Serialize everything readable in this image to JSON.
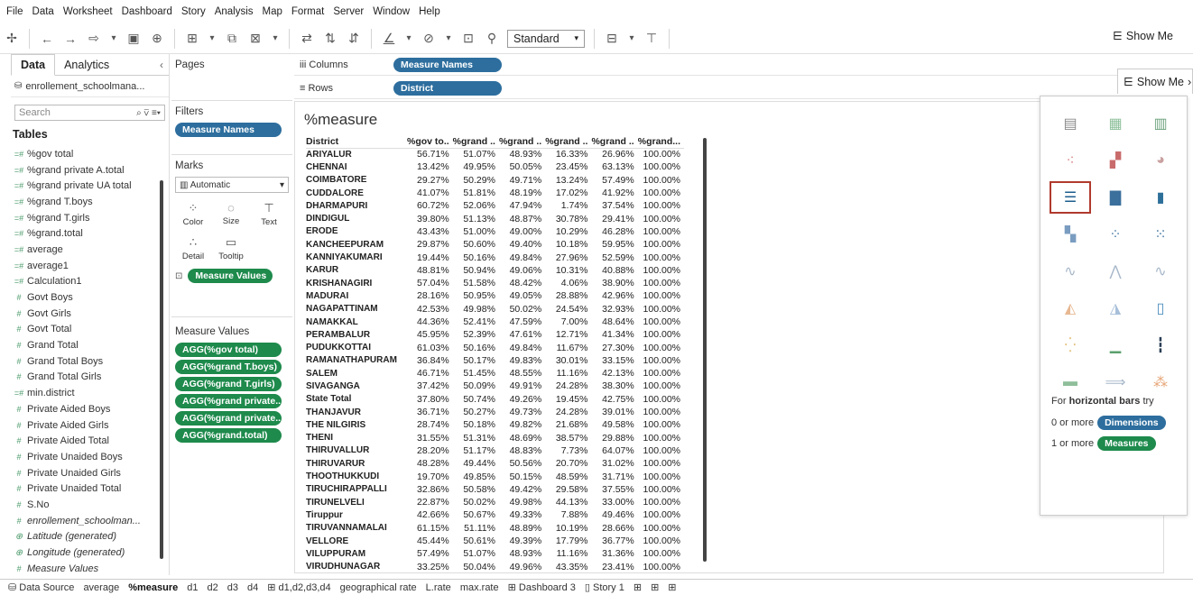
{
  "menu": [
    "File",
    "Data",
    "Worksheet",
    "Dashboard",
    "Story",
    "Analysis",
    "Map",
    "Format",
    "Server",
    "Window",
    "Help"
  ],
  "toolbar": {
    "fit": "Standard",
    "show_me": "Show Me"
  },
  "data_pane": {
    "tabs": [
      "Data",
      "Analytics"
    ],
    "source": "enrollement_schoolmana...",
    "search_placeholder": "Search",
    "tables_heading": "Tables",
    "fields": [
      {
        "type": "=#",
        "name": "%gov total",
        "italic": false
      },
      {
        "type": "=#",
        "name": "%grand private A.total",
        "italic": false
      },
      {
        "type": "=#",
        "name": "%grand private UA total",
        "italic": false
      },
      {
        "type": "=#",
        "name": "%grand T.boys",
        "italic": false
      },
      {
        "type": "=#",
        "name": "%grand T.girls",
        "italic": false
      },
      {
        "type": "=#",
        "name": "%grand.total",
        "italic": false
      },
      {
        "type": "=#",
        "name": "average",
        "italic": false
      },
      {
        "type": "=#",
        "name": "average1",
        "italic": false
      },
      {
        "type": "=#",
        "name": "Calculation1",
        "italic": false
      },
      {
        "type": "#",
        "name": "Govt Boys",
        "italic": false
      },
      {
        "type": "#",
        "name": "Govt Girls",
        "italic": false
      },
      {
        "type": "#",
        "name": "Govt Total",
        "italic": false
      },
      {
        "type": "#",
        "name": "Grand Total",
        "italic": false
      },
      {
        "type": "#",
        "name": "Grand Total Boys",
        "italic": false
      },
      {
        "type": "#",
        "name": "Grand Total Girls",
        "italic": false
      },
      {
        "type": "=#",
        "name": "min.district",
        "italic": false
      },
      {
        "type": "#",
        "name": "Private Aided Boys",
        "italic": false
      },
      {
        "type": "#",
        "name": "Private Aided Girls",
        "italic": false
      },
      {
        "type": "#",
        "name": "Private Aided Total",
        "italic": false
      },
      {
        "type": "#",
        "name": "Private Unaided Boys",
        "italic": false
      },
      {
        "type": "#",
        "name": "Private Unaided Girls",
        "italic": false
      },
      {
        "type": "#",
        "name": "Private Unaided Total",
        "italic": false
      },
      {
        "type": "#",
        "name": "S.No",
        "italic": false
      },
      {
        "type": "#",
        "name": "enrollement_schoolman...",
        "italic": true
      },
      {
        "type": "⊕",
        "name": "Latitude (generated)",
        "italic": true
      },
      {
        "type": "⊕",
        "name": "Longitude (generated)",
        "italic": true
      },
      {
        "type": "#",
        "name": "Measure Values",
        "italic": true
      }
    ]
  },
  "pages": {
    "title": "Pages"
  },
  "filters": {
    "title": "Filters",
    "pill": "Measure Names"
  },
  "marks": {
    "title": "Marks",
    "type": "Automatic",
    "buttons": [
      "Color",
      "Size",
      "Text",
      "Detail",
      "Tooltip"
    ],
    "pill": "Measure Values"
  },
  "measure_values": {
    "title": "Measure Values",
    "pills": [
      "AGG(%gov total)",
      "AGG(%grand T.boys)",
      "AGG(%grand T.girls)",
      "AGG(%grand private..",
      "AGG(%grand private..",
      "AGG(%grand.total)"
    ]
  },
  "shelves": {
    "columns_label": "Columns",
    "columns_pill": "Measure Names",
    "rows_label": "Rows",
    "rows_pill": "District"
  },
  "view": {
    "title": "%measure",
    "headers": [
      "District",
      "%gov to..",
      "%grand ..",
      "%grand ..",
      "%grand ..",
      "%grand ..",
      "%grand..."
    ],
    "rows": [
      [
        "ARIYALUR",
        "56.71%",
        "51.07%",
        "48.93%",
        "16.33%",
        "26.96%",
        "100.00%"
      ],
      [
        "CHENNAI",
        "13.42%",
        "49.95%",
        "50.05%",
        "23.45%",
        "63.13%",
        "100.00%"
      ],
      [
        "COIMBATORE",
        "29.27%",
        "50.29%",
        "49.71%",
        "13.24%",
        "57.49%",
        "100.00%"
      ],
      [
        "CUDDALORE",
        "41.07%",
        "51.81%",
        "48.19%",
        "17.02%",
        "41.92%",
        "100.00%"
      ],
      [
        "DHARMAPURI",
        "60.72%",
        "52.06%",
        "47.94%",
        "1.74%",
        "37.54%",
        "100.00%"
      ],
      [
        "DINDIGUL",
        "39.80%",
        "51.13%",
        "48.87%",
        "30.78%",
        "29.41%",
        "100.00%"
      ],
      [
        "ERODE",
        "43.43%",
        "51.00%",
        "49.00%",
        "10.29%",
        "46.28%",
        "100.00%"
      ],
      [
        "KANCHEEPURAM",
        "29.87%",
        "50.60%",
        "49.40%",
        "10.18%",
        "59.95%",
        "100.00%"
      ],
      [
        "KANNIYAKUMARI",
        "19.44%",
        "50.16%",
        "49.84%",
        "27.96%",
        "52.59%",
        "100.00%"
      ],
      [
        "KARUR",
        "48.81%",
        "50.94%",
        "49.06%",
        "10.31%",
        "40.88%",
        "100.00%"
      ],
      [
        "KRISHANAGIRI",
        "57.04%",
        "51.58%",
        "48.42%",
        "4.06%",
        "38.90%",
        "100.00%"
      ],
      [
        "MADURAI",
        "28.16%",
        "50.95%",
        "49.05%",
        "28.88%",
        "42.96%",
        "100.00%"
      ],
      [
        "NAGAPATTINAM",
        "42.53%",
        "49.98%",
        "50.02%",
        "24.54%",
        "32.93%",
        "100.00%"
      ],
      [
        "NAMAKKAL",
        "44.36%",
        "52.41%",
        "47.59%",
        "7.00%",
        "48.64%",
        "100.00%"
      ],
      [
        "PERAMBALUR",
        "45.95%",
        "52.39%",
        "47.61%",
        "12.71%",
        "41.34%",
        "100.00%"
      ],
      [
        "PUDUKKOTTAI",
        "61.03%",
        "50.16%",
        "49.84%",
        "11.67%",
        "27.30%",
        "100.00%"
      ],
      [
        "RAMANATHAPURAM",
        "36.84%",
        "50.17%",
        "49.83%",
        "30.01%",
        "33.15%",
        "100.00%"
      ],
      [
        "SALEM",
        "46.71%",
        "51.45%",
        "48.55%",
        "11.16%",
        "42.13%",
        "100.00%"
      ],
      [
        "SIVAGANGA",
        "37.42%",
        "50.09%",
        "49.91%",
        "24.28%",
        "38.30%",
        "100.00%"
      ],
      [
        "State Total",
        "37.80%",
        "50.74%",
        "49.26%",
        "19.45%",
        "42.75%",
        "100.00%"
      ],
      [
        "THANJAVUR",
        "36.71%",
        "50.27%",
        "49.73%",
        "24.28%",
        "39.01%",
        "100.00%"
      ],
      [
        "THE NILGIRIS",
        "28.74%",
        "50.18%",
        "49.82%",
        "21.68%",
        "49.58%",
        "100.00%"
      ],
      [
        "THENI",
        "31.55%",
        "51.31%",
        "48.69%",
        "38.57%",
        "29.88%",
        "100.00%"
      ],
      [
        "THIRUVALLUR",
        "28.20%",
        "51.17%",
        "48.83%",
        "7.73%",
        "64.07%",
        "100.00%"
      ],
      [
        "THIRUVARUR",
        "48.28%",
        "49.44%",
        "50.56%",
        "20.70%",
        "31.02%",
        "100.00%"
      ],
      [
        "THOOTHUKKUDI",
        "19.70%",
        "49.85%",
        "50.15%",
        "48.59%",
        "31.71%",
        "100.00%"
      ],
      [
        "TIRUCHIRAPPALLI",
        "32.86%",
        "50.58%",
        "49.42%",
        "29.58%",
        "37.55%",
        "100.00%"
      ],
      [
        "TIRUNELVELI",
        "22.87%",
        "50.02%",
        "49.98%",
        "44.13%",
        "33.00%",
        "100.00%"
      ],
      [
        "Tiruppur",
        "42.66%",
        "50.67%",
        "49.33%",
        "7.88%",
        "49.46%",
        "100.00%"
      ],
      [
        "TIRUVANNAMALAI",
        "61.15%",
        "51.11%",
        "48.89%",
        "10.19%",
        "28.66%",
        "100.00%"
      ],
      [
        "VELLORE",
        "45.44%",
        "50.61%",
        "49.39%",
        "17.79%",
        "36.77%",
        "100.00%"
      ],
      [
        "VILUPPURAM",
        "57.49%",
        "51.07%",
        "48.93%",
        "11.16%",
        "31.36%",
        "100.00%"
      ],
      [
        "VIRUDHUNAGAR",
        "33.25%",
        "50.04%",
        "49.96%",
        "43.35%",
        "23.41%",
        "100.00%"
      ]
    ]
  },
  "show_me": {
    "header": "Show Me",
    "hint_prefix": "For ",
    "hint_bold": "horizontal bars",
    "hint_suffix": " try",
    "dims_prefix": "0 or more",
    "dims_pill": "Dimensions",
    "meas_prefix": "1 or more",
    "meas_pill": "Measures"
  },
  "sheet_tabs": [
    "Data Source",
    "average",
    "%measure",
    "d1",
    "d2",
    "d3",
    "d4",
    "d1,d2,d3,d4",
    "geographical rate",
    "L.rate",
    "max.rate",
    "Dashboard 3",
    "Story 1"
  ],
  "active_tab": "%measure"
}
